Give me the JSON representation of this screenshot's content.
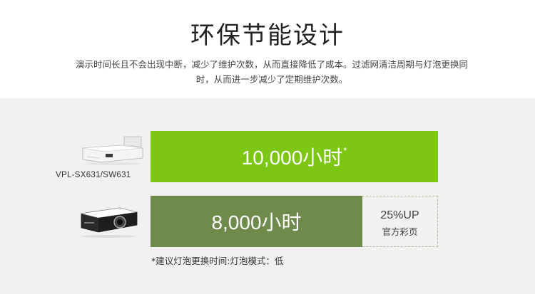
{
  "header": {
    "title": "环保节能设计",
    "description": "演示时间长且不会出现中断，减少了维护次数，从而直接降低了成本。过滤网清洁周期与灯泡更换同时，从而进一步减少了定期维护次数。"
  },
  "products": [
    {
      "model": "VPL-SX631/SW631",
      "image": "ultra-short-throw-projector",
      "lamp_life": "10,000小时",
      "note_mark": "*"
    },
    {
      "model": "",
      "image": "projector",
      "lamp_life": "8,000小时"
    }
  ],
  "comparison": {
    "value": "25%UP",
    "caption": "官方彩页"
  },
  "footnote": "*建议灯泡更换时间:灯泡模式：低",
  "colors": {
    "bar_primary": "#7dc613",
    "bar_secondary": "#6f8b4b"
  }
}
